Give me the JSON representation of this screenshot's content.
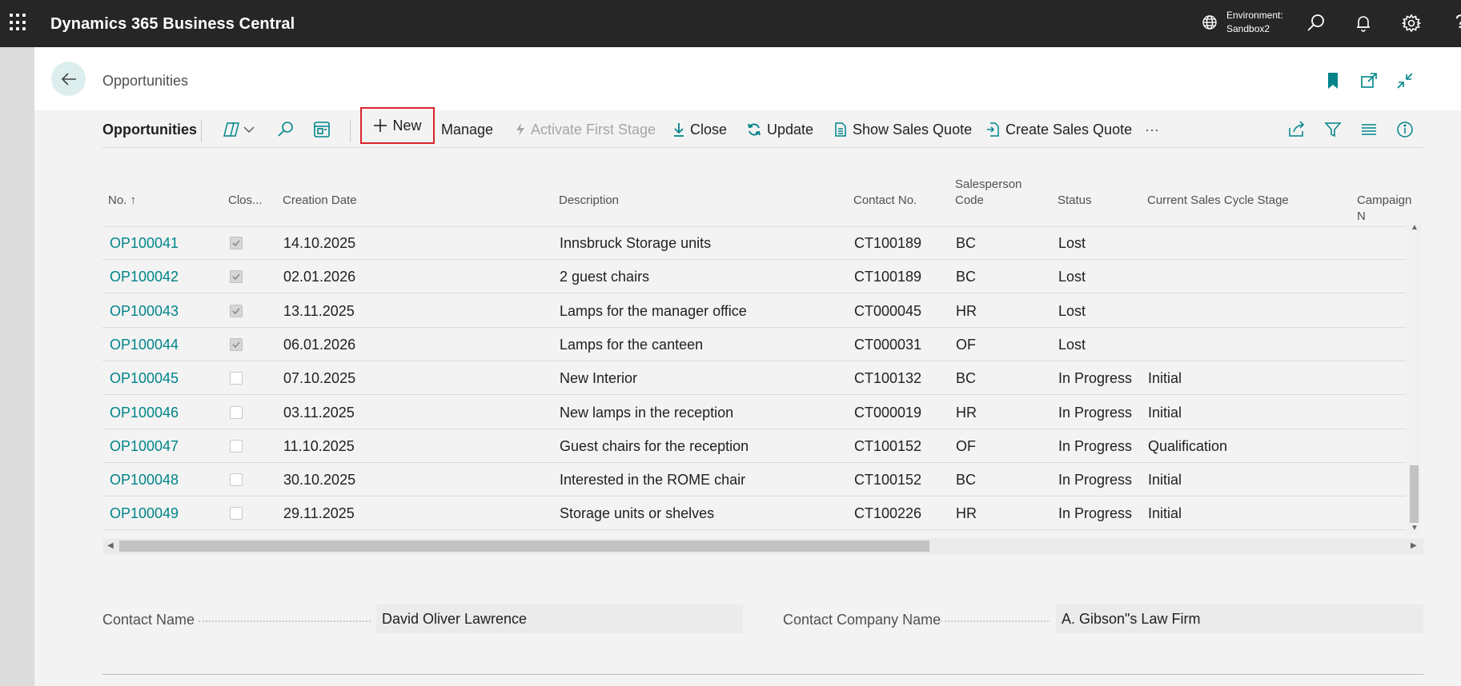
{
  "app": {
    "title": "Dynamics 365 Business Central",
    "environment_label": "Environment:",
    "environment_name": "Sandbox2",
    "help_glyph": "?"
  },
  "page": {
    "caption": "Opportunities"
  },
  "actionbar": {
    "title": "Opportunities",
    "new_label": "New",
    "manage_label": "Manage",
    "activate_label": "Activate First Stage",
    "close_label": "Close",
    "update_label": "Update",
    "show_quote_label": "Show Sales Quote",
    "create_quote_label": "Create Sales Quote",
    "more_label": "···"
  },
  "columns": {
    "no": "No. ↑",
    "closed": "Clos...",
    "creation_date": "Creation Date",
    "description": "Description",
    "contact_no": "Contact No.",
    "salesperson_line1": "Salesperson",
    "salesperson_line2": "Code",
    "status": "Status",
    "stage": "Current Sales Cycle Stage",
    "campaign": "Campaign N"
  },
  "rows": [
    {
      "no": "OP100041",
      "closed": true,
      "date": "14.10.2025",
      "description": "Innsbruck Storage units",
      "contact": "CT100189",
      "salesperson": "BC",
      "status": "Lost",
      "stage": ""
    },
    {
      "no": "OP100042",
      "closed": true,
      "date": "02.01.2026",
      "description": "2 guest chairs",
      "contact": "CT100189",
      "salesperson": "BC",
      "status": "Lost",
      "stage": ""
    },
    {
      "no": "OP100043",
      "closed": true,
      "date": "13.11.2025",
      "description": "Lamps for the manager office",
      "contact": "CT000045",
      "salesperson": "HR",
      "status": "Lost",
      "stage": ""
    },
    {
      "no": "OP100044",
      "closed": true,
      "date": "06.01.2026",
      "description": "Lamps for the canteen",
      "contact": "CT000031",
      "salesperson": "OF",
      "status": "Lost",
      "stage": ""
    },
    {
      "no": "OP100045",
      "closed": false,
      "date": "07.10.2025",
      "description": "New Interior",
      "contact": "CT100132",
      "salesperson": "BC",
      "status": "In Progress",
      "stage": "Initial"
    },
    {
      "no": "OP100046",
      "closed": false,
      "date": "03.11.2025",
      "description": "New lamps in the reception",
      "contact": "CT000019",
      "salesperson": "HR",
      "status": "In Progress",
      "stage": "Initial"
    },
    {
      "no": "OP100047",
      "closed": false,
      "date": "11.10.2025",
      "description": "Guest chairs for the reception",
      "contact": "CT100152",
      "salesperson": "OF",
      "status": "In Progress",
      "stage": "Qualification"
    },
    {
      "no": "OP100048",
      "closed": false,
      "date": "30.10.2025",
      "description": "Interested in the ROME chair",
      "contact": "CT100152",
      "salesperson": "BC",
      "status": "In Progress",
      "stage": "Initial"
    },
    {
      "no": "OP100049",
      "closed": false,
      "date": "29.11.2025",
      "description": "Storage units or shelves",
      "contact": "CT100226",
      "salesperson": "HR",
      "status": "In Progress",
      "stage": "Initial"
    }
  ],
  "fields": {
    "contact_name_label": "Contact Name",
    "contact_name_value": "David Oliver Lawrence",
    "company_name_label": "Contact Company Name",
    "company_name_value": "A. Gibson\"s Law Firm"
  },
  "colors": {
    "link": "#008489",
    "highlight_border": "#d9242d",
    "topbar": "#262626"
  }
}
